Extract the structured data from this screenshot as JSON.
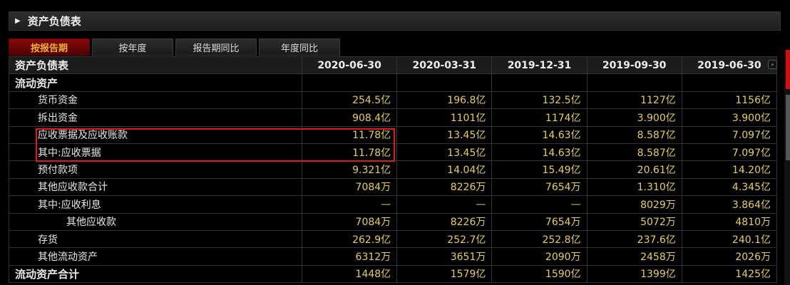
{
  "title": "资产负债表",
  "tabs": [
    "按报告期",
    "按年度",
    "报告期同比",
    "年度同比"
  ],
  "table": {
    "header": "资产负债表",
    "dates": [
      "2020-06-30",
      "2020-03-31",
      "2019-12-31",
      "2019-09-30",
      "2019-06-30"
    ],
    "rows": [
      {
        "label": "流动资产",
        "values": [
          "",
          "",
          "",
          "",
          ""
        ]
      },
      {
        "label": "货币资金",
        "values": [
          "254.5亿",
          "196.8亿",
          "132.5亿",
          "1127亿",
          "1156亿"
        ]
      },
      {
        "label": "拆出资金",
        "values": [
          "908.4亿",
          "1101亿",
          "1174亿",
          "3.900亿",
          "3.900亿"
        ]
      },
      {
        "label": "应收票据及应收账款",
        "values": [
          "11.78亿",
          "13.45亿",
          "14.63亿",
          "8.587亿",
          "7.097亿"
        ]
      },
      {
        "label": "其中:应收票据",
        "values": [
          "11.78亿",
          "13.45亿",
          "14.63亿",
          "8.587亿",
          "7.097亿"
        ]
      },
      {
        "label": "预付款项",
        "values": [
          "9.321亿",
          "14.04亿",
          "15.49亿",
          "20.61亿",
          "14.20亿"
        ]
      },
      {
        "label": "其他应收款合计",
        "values": [
          "7084万",
          "8226万",
          "7654万",
          "1.310亿",
          "4.345亿"
        ]
      },
      {
        "label": "其中:应收利息",
        "values": [
          "—",
          "—",
          "—",
          "8029万",
          "3.864亿"
        ]
      },
      {
        "label": "其他应收款",
        "values": [
          "7084万",
          "8226万",
          "7654万",
          "5072万",
          "4810万"
        ]
      },
      {
        "label": "存货",
        "values": [
          "262.9亿",
          "252.7亿",
          "252.8亿",
          "237.6亿",
          "240.1亿"
        ]
      },
      {
        "label": "其他流动资产",
        "values": [
          "6312万",
          "3651万",
          "2090万",
          "2458万",
          "2026万"
        ]
      },
      {
        "label": "流动资产合计",
        "values": [
          "1448亿",
          "1579亿",
          "1590亿",
          "1399亿",
          "1425亿"
        ]
      }
    ]
  },
  "colors": {
    "value": "#e6d050",
    "active_tab": "#8a0a0a",
    "highlight": "#e01818"
  }
}
